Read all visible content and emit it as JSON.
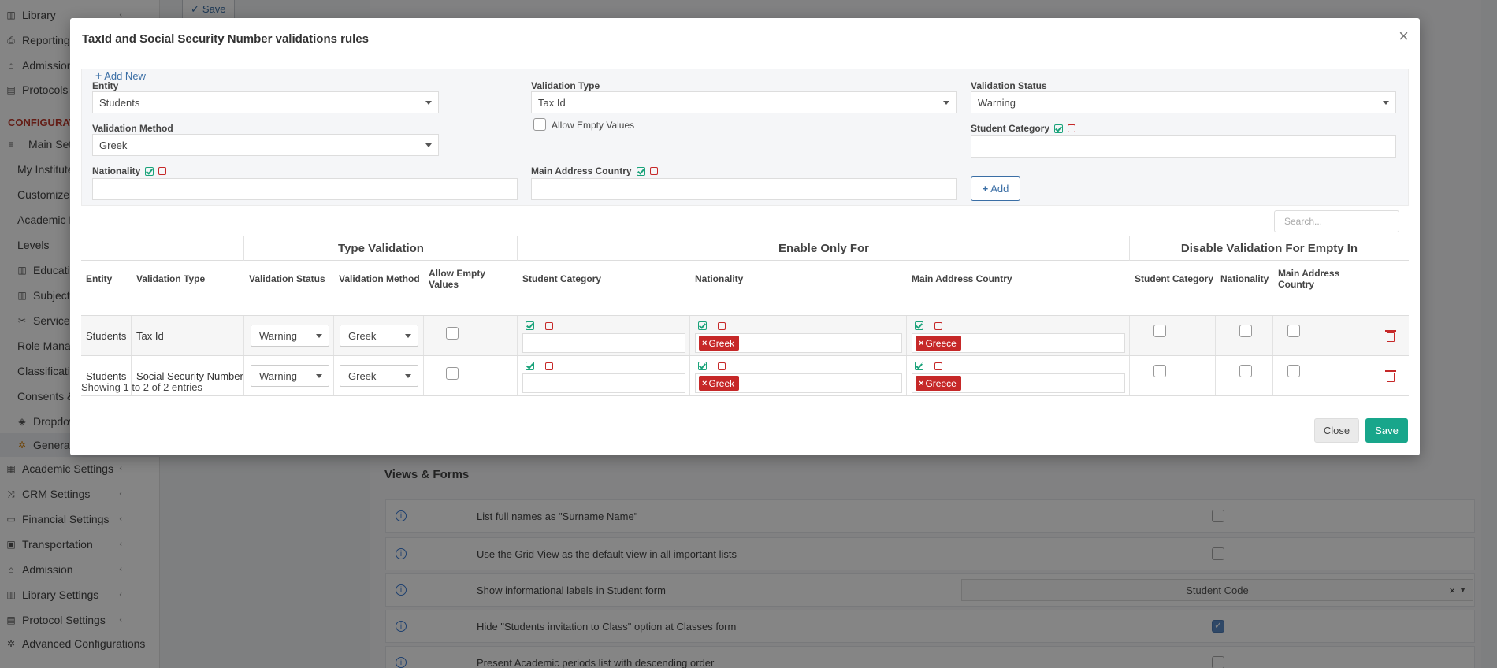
{
  "sidebar": {
    "items": [
      {
        "label": "Library",
        "icon": "books-icon",
        "chevron": true
      },
      {
        "label": "Reporting",
        "icon": "printer-icon",
        "chevron": false
      },
      {
        "label": "Admission",
        "icon": "building-icon",
        "chevron": false
      },
      {
        "label": "Protocols",
        "icon": "clipboard-icon",
        "chevron": false
      },
      {
        "label": "CONFIGURAT",
        "icon": "",
        "chevron": false
      },
      {
        "label": "Main Setti",
        "icon": "sliders-icon",
        "chevron": false
      },
      {
        "label": "My Institute",
        "icon": "",
        "chevron": false
      },
      {
        "label": "Customize T",
        "icon": "",
        "chevron": false
      },
      {
        "label": "Academic P",
        "icon": "",
        "chevron": false
      },
      {
        "label": "Levels",
        "icon": "",
        "chevron": false
      },
      {
        "label": "Educatio",
        "icon": "book-icon",
        "chevron": false
      },
      {
        "label": "Subjects",
        "icon": "book-icon",
        "chevron": false
      },
      {
        "label": "Services",
        "icon": "scissors-icon",
        "chevron": false
      },
      {
        "label": "Role Manag",
        "icon": "",
        "chevron": false
      },
      {
        "label": "Classificatio",
        "icon": "",
        "chevron": false
      },
      {
        "label": "Consents &",
        "icon": "",
        "chevron": false
      },
      {
        "label": "Dropdow",
        "icon": "layers-icon",
        "chevron": false
      },
      {
        "label": "General",
        "icon": "gear-icon",
        "chevron": false
      },
      {
        "label": "Academic Settings",
        "icon": "grid-icon",
        "chevron": true
      },
      {
        "label": "CRM Settings",
        "icon": "shuffle-icon",
        "chevron": true
      },
      {
        "label": "Financial Settings",
        "icon": "money-icon",
        "chevron": true
      },
      {
        "label": "Transportation",
        "icon": "bus-icon",
        "chevron": true
      },
      {
        "label": "Admission",
        "icon": "building-icon",
        "chevron": true
      },
      {
        "label": "Library Settings",
        "icon": "books-icon",
        "chevron": true
      },
      {
        "label": "Protocol Settings",
        "icon": "clipboard-icon",
        "chevron": true
      },
      {
        "label": "Advanced Configurations",
        "icon": "gear-icon",
        "chevron": false
      }
    ]
  },
  "toolbar": {
    "save_label": "Save"
  },
  "background": {
    "views_title": "Views & Forms",
    "rows": [
      {
        "text": "List full names as \"Surname Name\"",
        "checked": false
      },
      {
        "text": "Use the Grid View as the default view in all important lists",
        "checked": false
      },
      {
        "text": "Show informational labels in Student form",
        "select_value": "Student Code"
      },
      {
        "text": "Hide \"Students invitation to Class\" option at Classes form",
        "checked": true
      },
      {
        "text": "Present Academic periods list with descending order",
        "checked": false
      }
    ]
  },
  "modal": {
    "title": "TaxId and Social Security Number validations rules",
    "close_symbol": "×",
    "add_new_label": "Add New",
    "form": {
      "entity_label": "Entity",
      "entity_value": "Students",
      "validation_type_label": "Validation Type",
      "validation_type_value": "Tax Id",
      "validation_status_label": "Validation Status",
      "validation_status_value": "Warning",
      "validation_method_label": "Validation Method",
      "validation_method_value": "Greek",
      "allow_empty_label": "Allow Empty Values",
      "student_category_label": "Student Category",
      "nationality_label": "Nationality",
      "main_address_country_label": "Main Address Country",
      "add_button_label": "Add"
    },
    "search_placeholder": "Search...",
    "table": {
      "groups": {
        "type_validation": "Type Validation",
        "enable_only_for": "Enable Only For",
        "disable_validation": "Disable Validation For Empty In"
      },
      "columns": [
        "Entity",
        "Validation Type",
        "Validation Status",
        "Validation Method",
        "Allow Empty Values",
        "Student Category",
        "Nationality",
        "Main Address Country",
        "Student Category",
        "Nationality",
        "Main Address Country"
      ],
      "rows": [
        {
          "entity": "Students",
          "validation_type": "Tax Id",
          "status": "Warning",
          "method": "Greek",
          "nationality_tag": "Greek",
          "country_tag": "Greece"
        },
        {
          "entity": "Students",
          "validation_type": "Social Security Number",
          "status": "Warning",
          "method": "Greek",
          "nationality_tag": "Greek",
          "country_tag": "Greece"
        }
      ],
      "tag_remove_symbol": "×"
    },
    "showing_text": "Showing 1 to 2 of 2 entries",
    "close_button": "Close",
    "save_button": "Save"
  },
  "colors": {
    "accent": "#18a68b",
    "danger": "#c62828",
    "link": "#3a6ea5",
    "check_green": "#1aa37a"
  }
}
